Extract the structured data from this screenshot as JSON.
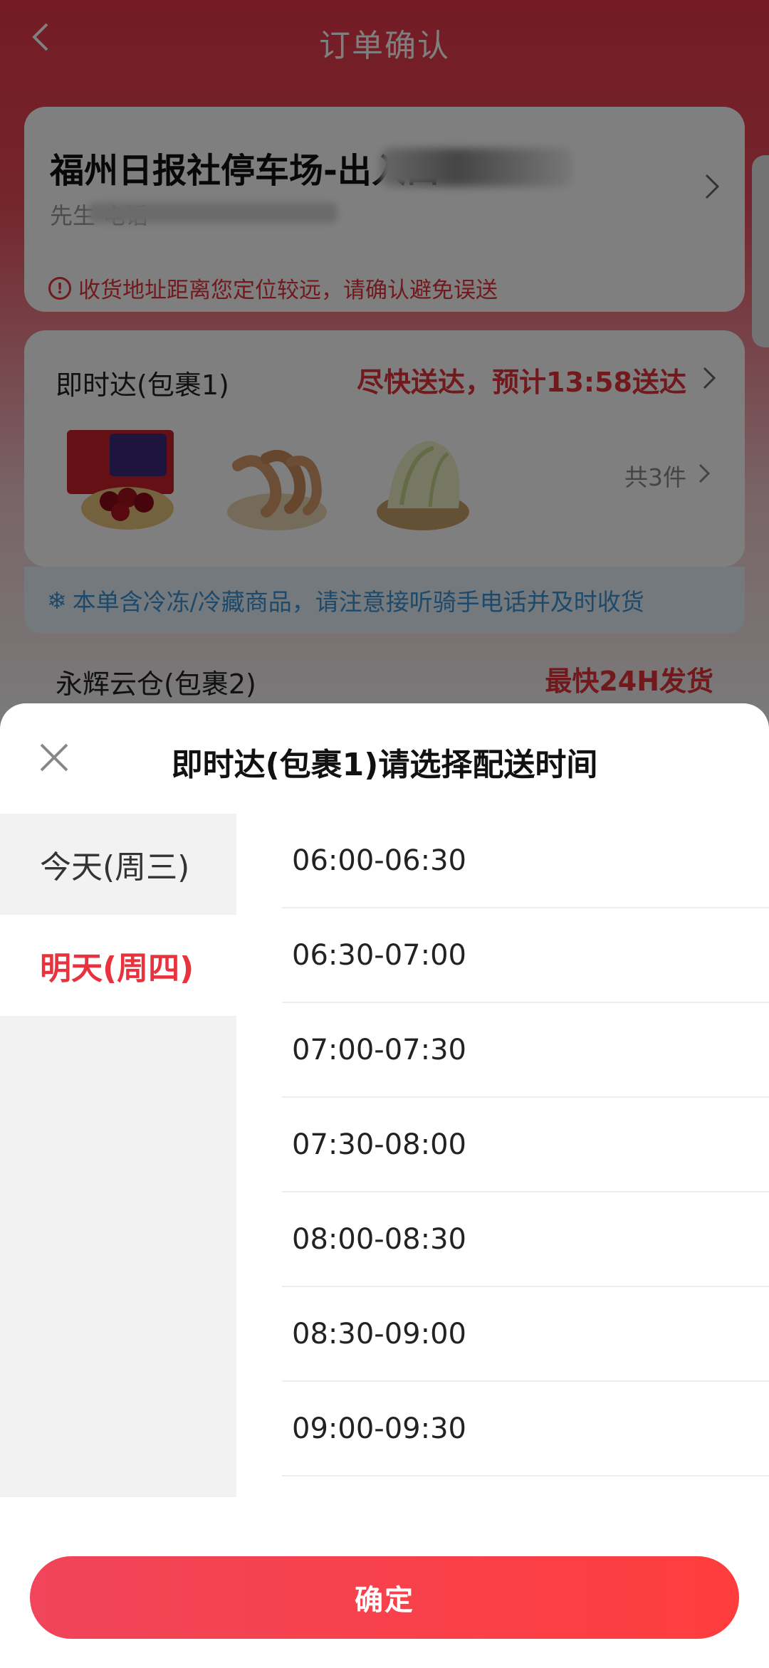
{
  "nav": {
    "title": "订单确认"
  },
  "address": {
    "title": "福州日报社停车场-出入口",
    "subtitle": "先生 电话",
    "warning": "收货地址距离您定位较远，请确认避免误送"
  },
  "package1": {
    "name": "即时达(包裹1)",
    "eta": "尽快送达，预计13:58送达",
    "count": "共3件",
    "products": [
      "cherries-box",
      "shrimp",
      "napa-cabbage"
    ]
  },
  "cold_note": "本单含冷冻/冷藏商品，请注意接听骑手电话并及时收货",
  "package2": {
    "name": "永辉云仓(包裹2)",
    "tag": "最快24H发货"
  },
  "sheet": {
    "title": "即时达(包裹1)请选择配送时间",
    "days": [
      {
        "label": "今天(周三)",
        "active": false
      },
      {
        "label": "明天(周四)",
        "active": true
      }
    ],
    "slots": [
      "06:00-06:30",
      "06:30-07:00",
      "07:00-07:30",
      "07:30-08:00",
      "08:00-08:30",
      "08:30-09:00",
      "09:00-09:30"
    ],
    "confirm_label": "确定"
  },
  "colors": {
    "accent": "#e8333f",
    "confirm_gradient_start": "#f0455a",
    "confirm_gradient_end": "#ff3d3d",
    "note_blue": "#3b93d6"
  }
}
